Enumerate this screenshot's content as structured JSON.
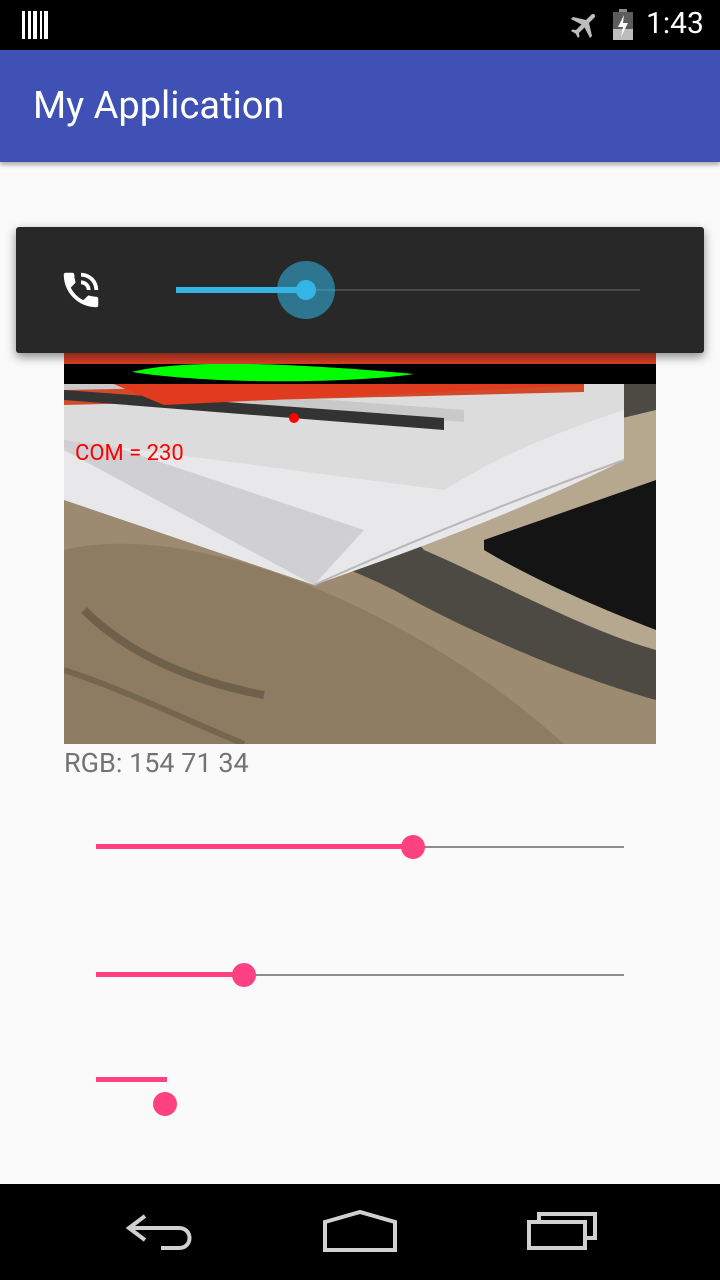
{
  "status_bar": {
    "time": "1:43",
    "icons": [
      "barcode-icon",
      "airplane-mode-icon",
      "battery-charging-icon"
    ]
  },
  "app_bar": {
    "title": "My Application"
  },
  "camera": {
    "com_label": "COM = 230"
  },
  "rgb_label": "RGB: 154 71 34",
  "seekbars": [
    {
      "name": "seekbar-1",
      "value": 0.6
    },
    {
      "name": "seekbar-2",
      "value": 0.28
    },
    {
      "name": "seekbar-3",
      "value": 0.13
    }
  ],
  "volume_panel": {
    "stream": "in-call-volume",
    "icon": "phone-in-call-icon",
    "value": 0.28
  },
  "colors": {
    "app_bar": "#3f51b5",
    "accent": "#ff4081",
    "volume_accent": "#33b5e5"
  },
  "nav_bar": {
    "icons": [
      "back-icon",
      "home-icon",
      "recents-icon"
    ]
  }
}
